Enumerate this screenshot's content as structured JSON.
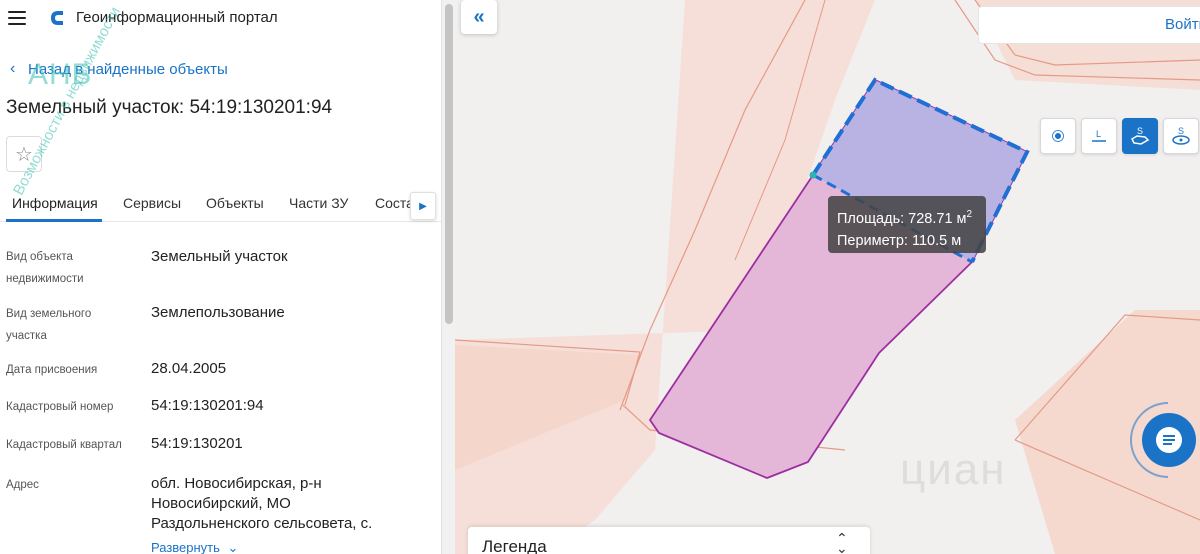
{
  "app": {
    "title": "Геоинформационный портал"
  },
  "nav": {
    "back_label": "Назад в найденные объекты"
  },
  "object": {
    "title": "Земельный участок: 54:19:130201:94"
  },
  "tabs": [
    {
      "label": "Информация",
      "active": true
    },
    {
      "label": "Сервисы",
      "active": false
    },
    {
      "label": "Объекты",
      "active": false
    },
    {
      "label": "Части ЗУ",
      "active": false
    },
    {
      "label": "Соста",
      "active": false
    }
  ],
  "properties": [
    {
      "label": "Вид объекта недвижимости",
      "value": "Земельный участок"
    },
    {
      "label": "Вид земельного участка",
      "value": "Землепользование"
    },
    {
      "label": "Дата присвоения",
      "value": "28.04.2005"
    },
    {
      "label": "Кадастровый номер",
      "value": "54:19:130201:94"
    },
    {
      "label": "Кадастровый квартал",
      "value": "54:19:130201"
    },
    {
      "label": "Адрес",
      "value": "обл. Новосибирская, р-н Новосибирский, МО Раздольненского сельсовета, с."
    }
  ],
  "expand_label": "Развернуть",
  "watermark": {
    "brand": "АНБ",
    "slogan": "Возможности в недвижимости",
    "map_brand": "циан"
  },
  "map": {
    "login_label": "Войти",
    "measure": {
      "area_label": "Площадь: 728.71 м",
      "area_unit_power": "2",
      "perimeter_label": "Периметр: 110.5 м"
    },
    "legend_label": "Легенда",
    "tools": [
      "point-tool-icon",
      "line-tool-icon",
      "area-tool-icon",
      "radius-tool-icon"
    ]
  },
  "colors": {
    "accent": "#1a73c7",
    "parcel_fill": "#e4b7d9",
    "parcel_stroke": "#9c2fa0",
    "measure_fill": "#b3b3e3",
    "measure_stroke": "#1f6fd4",
    "map_lines": "#e59a86"
  }
}
